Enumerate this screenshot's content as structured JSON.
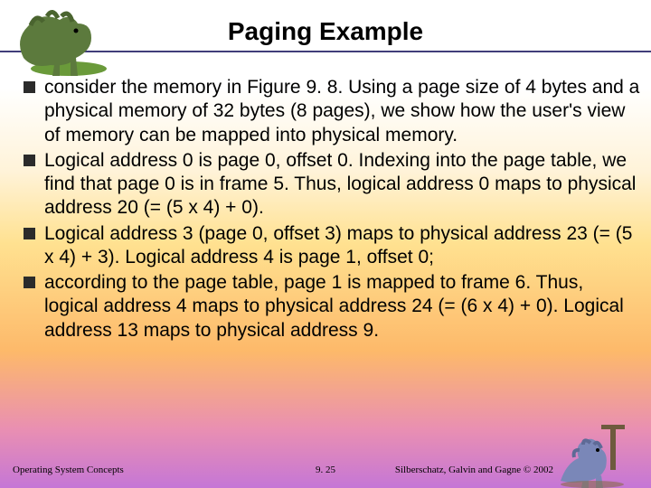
{
  "title": "Paging Example",
  "bullets": [
    "consider the memory in Figure 9. 8. Using a page size of 4 bytes and a physical memory of 32 bytes (8 pages), we show how the user's view of memory can be mapped into physical memory.",
    "Logical address 0 is page 0, offset 0. Indexing into the page table, we find that page 0 is in frame 5. Thus, logical address 0 maps to physical address 20 (= (5 x 4) + 0).",
    "Logical address 3 (page 0, offset 3) maps to physical address 23 (= (5 x 4) + 3). Logical address 4 is page 1, offset 0;",
    "according to the page table, page 1 is mapped to frame 6. Thus, logical address 4 maps to physical address 24 (= (6 x 4) + 0). Logical address 13 maps to physical address 9."
  ],
  "footer": {
    "left": "Operating System Concepts",
    "center": "9. 25",
    "right": "Silberschatz, Galvin and Gagne © 2002"
  },
  "decor": {
    "dino_left": "dinosaur-left-icon",
    "dino_right": "dinosaur-right-icon"
  }
}
